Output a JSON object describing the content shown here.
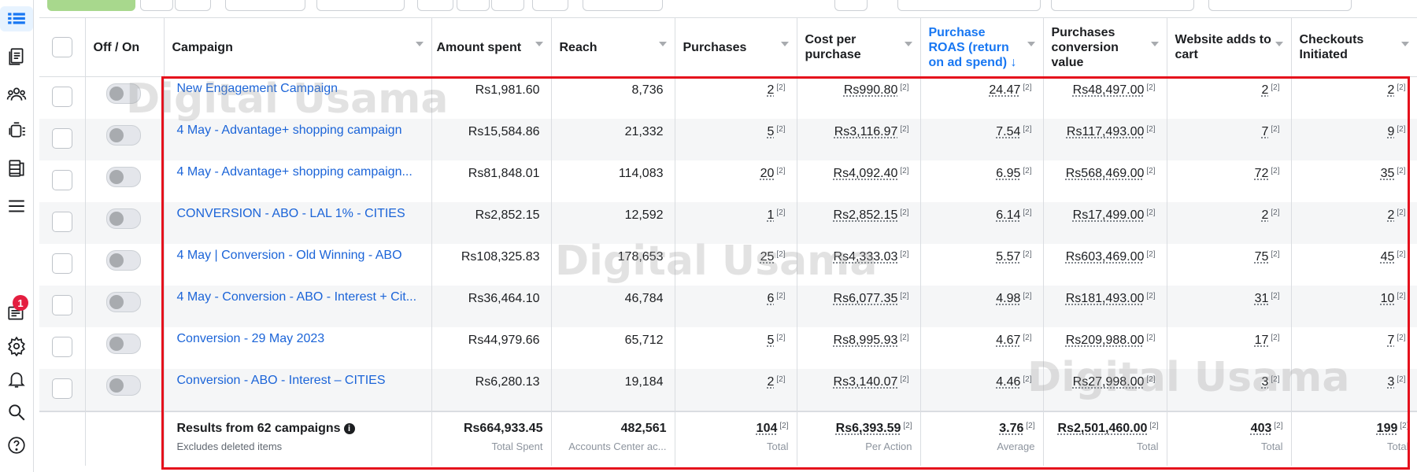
{
  "left_nav": {
    "icons": [
      "grid-table-icon",
      "pages-icon",
      "audience-icon",
      "copy-stack-icon",
      "database-icon",
      "menu-lines-icon",
      "news-feed-icon",
      "settings-gear-icon",
      "bell-icon",
      "search-icon",
      "help-icon"
    ],
    "notification_count": "1"
  },
  "columns": {
    "off_on": "Off / On",
    "campaign": "Campaign",
    "amount_spent": "Amount spent",
    "reach": "Reach",
    "purchases": "Purchases",
    "cost_per_purchase": "Cost per purchase",
    "roas": "Purchase ROAS (return on ad spend) ↓",
    "conversion_value": "Purchases conversion value",
    "adds_to_cart": "Website adds to cart",
    "checkouts": "Checkouts Initiated"
  },
  "footnote": "[2]",
  "rows": [
    {
      "name": "New Engagement Campaign",
      "spent": "Rs1,981.60",
      "reach": "8,736",
      "purchases": "2",
      "cpp": "Rs990.80",
      "roas": "24.47",
      "value": "Rs48,497.00",
      "cart": "2",
      "checkouts": "2"
    },
    {
      "name": "4 May - Advantage+ shopping campaign",
      "spent": "Rs15,584.86",
      "reach": "21,332",
      "purchases": "5",
      "cpp": "Rs3,116.97",
      "roas": "7.54",
      "value": "Rs117,493.00",
      "cart": "7",
      "checkouts": "9"
    },
    {
      "name": "4 May - Advantage+ shopping campaign...",
      "spent": "Rs81,848.01",
      "reach": "114,083",
      "purchases": "20",
      "cpp": "Rs4,092.40",
      "roas": "6.95",
      "value": "Rs568,469.00",
      "cart": "72",
      "checkouts": "35"
    },
    {
      "name": "CONVERSION - ABO - LAL 1% - CITIES",
      "spent": "Rs2,852.15",
      "reach": "12,592",
      "purchases": "1",
      "cpp": "Rs2,852.15",
      "roas": "6.14",
      "value": "Rs17,499.00",
      "cart": "2",
      "checkouts": "2"
    },
    {
      "name": "4 May | Conversion - Old Winning - ABO",
      "spent": "Rs108,325.83",
      "reach": "178,653",
      "purchases": "25",
      "cpp": "Rs4,333.03",
      "roas": "5.57",
      "value": "Rs603,469.00",
      "cart": "75",
      "checkouts": "45"
    },
    {
      "name": "4 May - Conversion - ABO - Interest + Cit...",
      "spent": "Rs36,464.10",
      "reach": "46,784",
      "purchases": "6",
      "cpp": "Rs6,077.35",
      "roas": "4.98",
      "value": "Rs181,493.00",
      "cart": "31",
      "checkouts": "10"
    },
    {
      "name": "Conversion - 29 May 2023",
      "spent": "Rs44,979.66",
      "reach": "65,712",
      "purchases": "5",
      "cpp": "Rs8,995.93",
      "roas": "4.67",
      "value": "Rs209,988.00",
      "cart": "17",
      "checkouts": "7"
    },
    {
      "name": "Conversion - ABO - Interest – CITIES",
      "spent": "Rs6,280.13",
      "reach": "19,184",
      "purchases": "2",
      "cpp": "Rs3,140.07",
      "roas": "4.46",
      "value": "Rs27,998.00",
      "cart": "3",
      "checkouts": "3"
    }
  ],
  "totals": {
    "title": "Results from 62 campaigns",
    "subtitle": "Excludes deleted items",
    "spent": "Rs664,933.45",
    "spent_label": "Total Spent",
    "reach": "482,561",
    "reach_label": "Accounts Center ac...",
    "purchases": "104",
    "purchases_label": "Total",
    "cpp": "Rs6,393.59",
    "cpp_label": "Per Action",
    "roas": "3.76",
    "roas_label": "Average",
    "value": "Rs2,501,460.00",
    "value_label": "Total",
    "cart": "403",
    "cart_label": "Total",
    "checkouts": "199",
    "checkouts_label": "Total"
  },
  "watermark": "Digital Usama",
  "colors": {
    "link": "#1b64d8",
    "highlight_frame": "#e5101c",
    "active_header": "#1877f2",
    "notification": "#e41e3f"
  }
}
